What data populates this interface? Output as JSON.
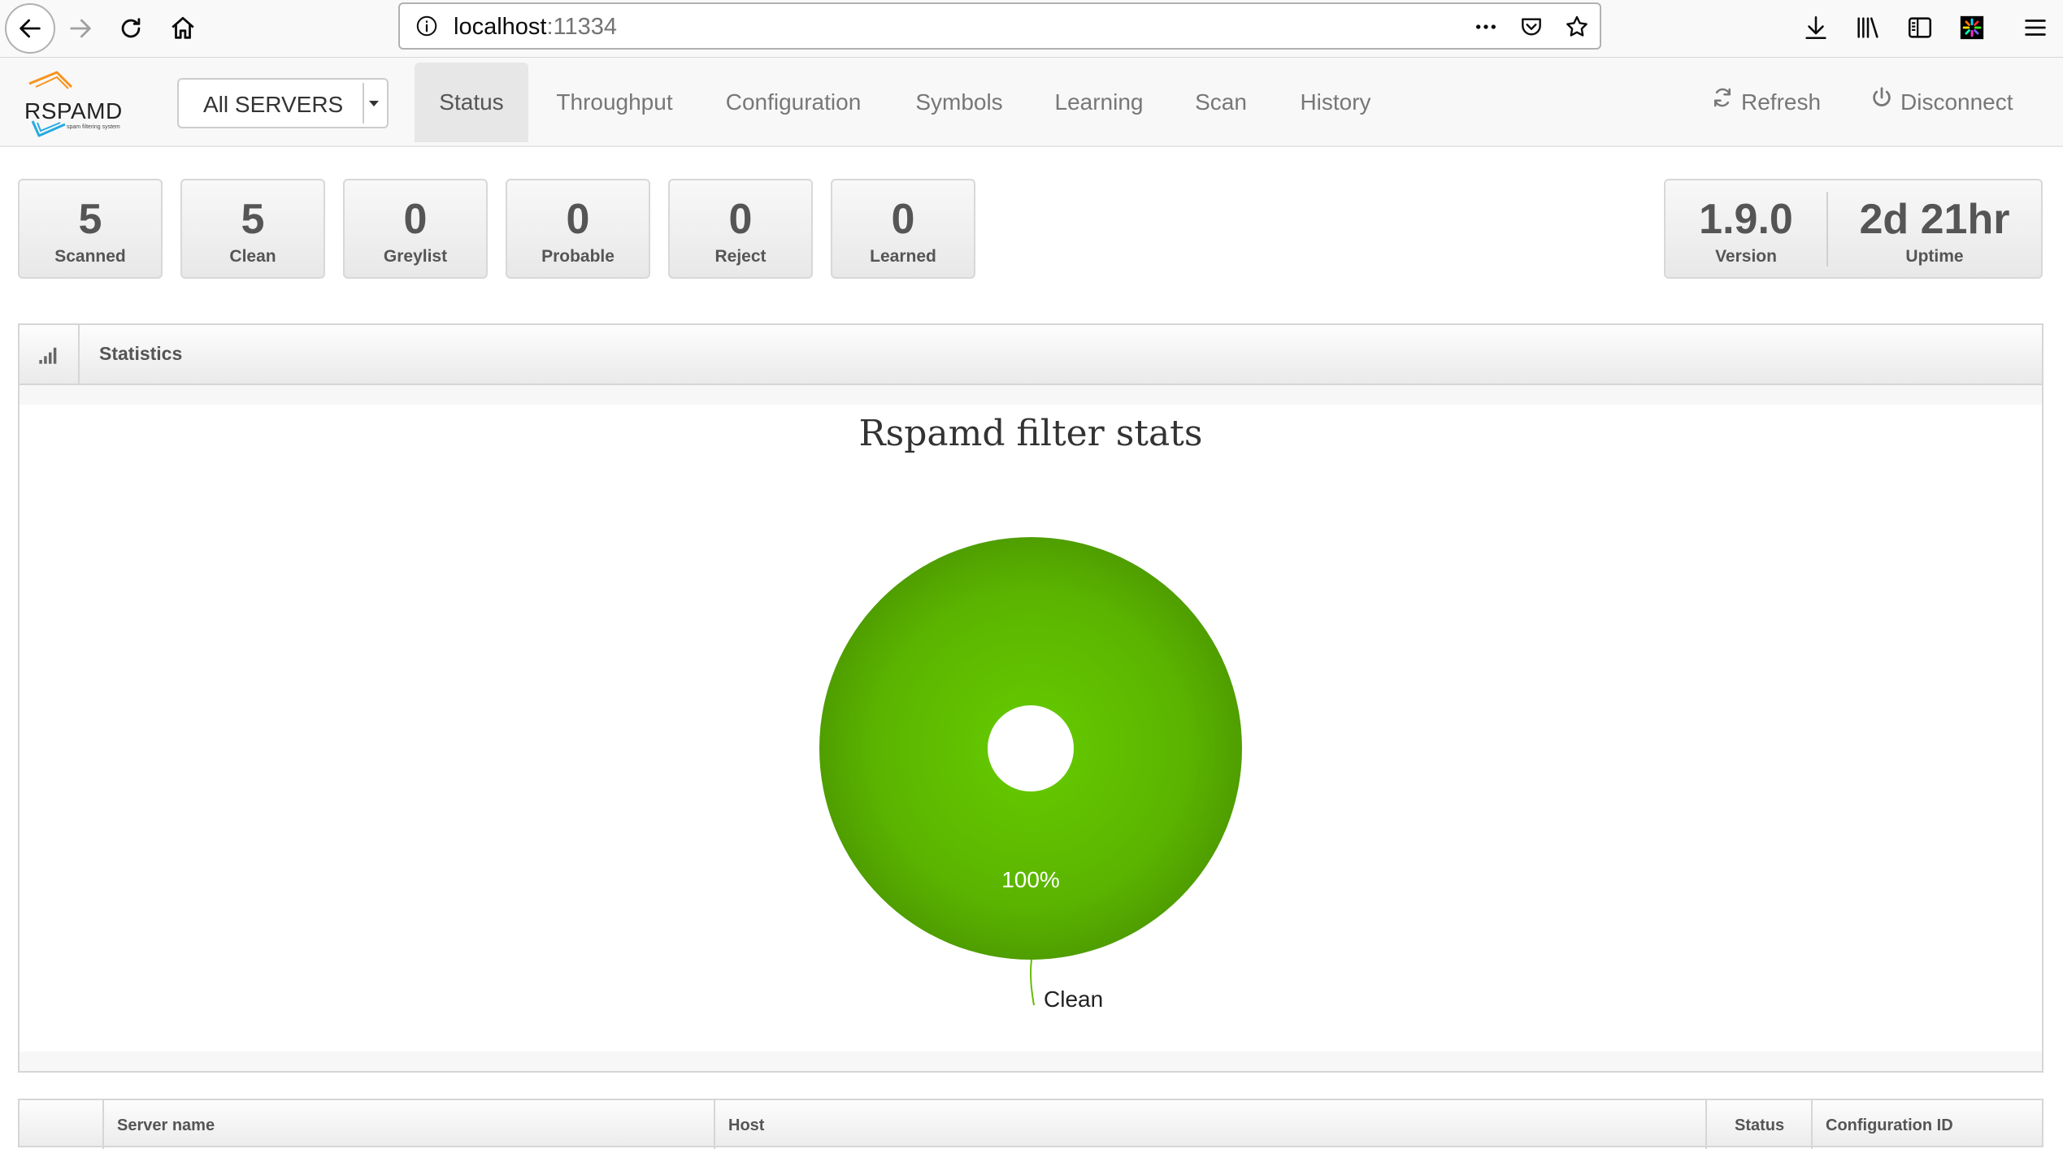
{
  "browser": {
    "url_host": "localhost",
    "url_port": ":11334"
  },
  "navbar": {
    "logo_text": "RSPAMD",
    "logo_subtitle": "spam filtering system",
    "server_select": "All SERVERS",
    "tabs": [
      "Status",
      "Throughput",
      "Configuration",
      "Symbols",
      "Learning",
      "Scan",
      "History"
    ],
    "active_tab": "Status",
    "refresh_label": "Refresh",
    "disconnect_label": "Disconnect"
  },
  "stats": [
    {
      "value": "5",
      "label": "Scanned"
    },
    {
      "value": "5",
      "label": "Clean"
    },
    {
      "value": "0",
      "label": "Greylist"
    },
    {
      "value": "0",
      "label": "Probable"
    },
    {
      "value": "0",
      "label": "Reject"
    },
    {
      "value": "0",
      "label": "Learned"
    }
  ],
  "version": {
    "value": "1.9.0",
    "label": "Version"
  },
  "uptime": {
    "value": "2d 21hr",
    "label": "Uptime"
  },
  "statistics_panel": {
    "title": "Statistics"
  },
  "chart_data": {
    "type": "pie",
    "title": "Rspamd filter stats",
    "categories": [
      "Clean"
    ],
    "values": [
      100
    ],
    "value_labels": [
      "100%"
    ],
    "colors": [
      "#66bb00"
    ]
  },
  "servers_table": {
    "columns": [
      "Server name",
      "Host",
      "Status",
      "Configuration ID"
    ]
  },
  "colors": {
    "clean_green": "#66bb00",
    "navbar_bg": "#f8f8f8"
  }
}
